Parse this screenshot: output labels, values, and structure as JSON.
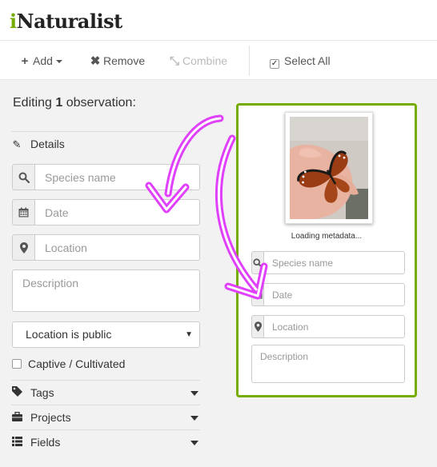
{
  "brand": {
    "initial": "i",
    "rest": "Naturalist",
    "accent_color": "#74ac00"
  },
  "toolbar": {
    "add_label": "Add",
    "remove_label": "Remove",
    "combine_label": "Combine",
    "select_all_label": "Select All",
    "select_all_checked": true
  },
  "editing": {
    "prefix": "Editing ",
    "count": "1",
    "suffix": " observation:"
  },
  "sections": {
    "details": "Details",
    "tags": "Tags",
    "projects": "Projects",
    "fields": "Fields"
  },
  "form": {
    "species_placeholder": "Species name",
    "date_placeholder": "Date",
    "location_placeholder": "Location",
    "description_placeholder": "Description",
    "geoprivacy_selected": "Location is public",
    "captive_label": "Captive / Cultivated",
    "captive_checked": false
  },
  "card": {
    "status": "Loading metadata...",
    "species_placeholder": "Species name",
    "date_placeholder": "Date",
    "location_placeholder": "Location",
    "description_placeholder": "Description",
    "border_color": "#74ac00"
  },
  "annotation": {
    "arrow_color": "#e040fb"
  }
}
